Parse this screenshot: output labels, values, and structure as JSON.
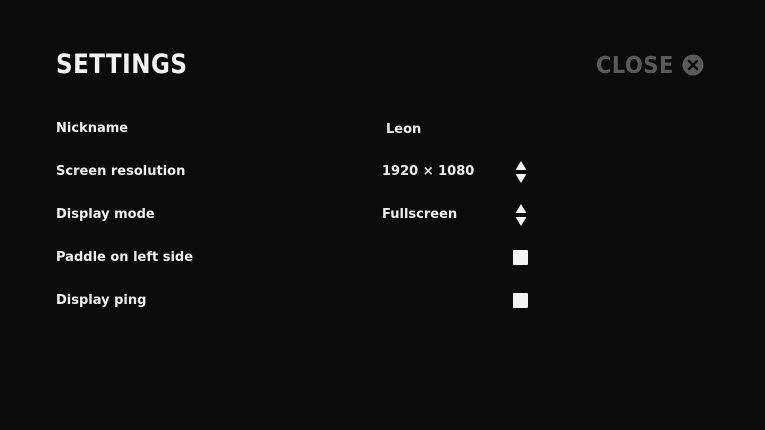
{
  "header": {
    "title": "SETTINGS",
    "close_label": "CLOSE",
    "close_icon": "close-circle-icon"
  },
  "colors": {
    "background": "#0b0b0b",
    "text": "#f2f2f2",
    "close_muted": "#5a5a5a",
    "checkbox": "#f5f5f5"
  },
  "settings": {
    "nickname": {
      "label": "Nickname",
      "value": "Leon"
    },
    "resolution": {
      "label": "Screen resolution",
      "value": "1920 × 1080",
      "control_icon": "up-down-arrows-icon"
    },
    "display_mode": {
      "label": "Display mode",
      "value": "Fullscreen",
      "control_icon": "up-down-arrows-icon"
    },
    "paddle_left": {
      "label": "Paddle on left side",
      "checked": false
    },
    "display_ping": {
      "label": "Display ping",
      "checked": false
    }
  }
}
